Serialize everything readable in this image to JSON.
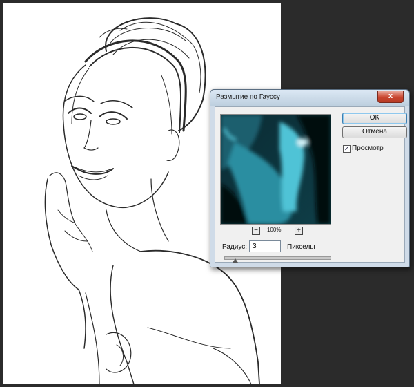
{
  "dialog": {
    "title": "Размытие по Гауссу",
    "close_glyph": "x",
    "ok_label": "OK",
    "cancel_label": "Отмена",
    "preview_label": "Просмотр",
    "preview_checked": true,
    "check_glyph": "✓",
    "zoom_level": "100%",
    "zoom_out_glyph": "−",
    "zoom_in_glyph": "+",
    "radius_label": "Радиус:",
    "radius_value": "3",
    "units_label": "Пикселы",
    "slider_value_fraction": 0.1
  },
  "colors": {
    "workspace_bg": "#2b2b2b",
    "document_bg": "#ffffff",
    "dialog_frame": "#cfdbe8",
    "preview_tint": "#4fc3d6",
    "close_button": "#c9452f"
  },
  "icons": {
    "close": "close-icon",
    "zoom_out": "zoom-out-icon",
    "zoom_in": "zoom-in-icon",
    "checkbox": "checkmark-icon"
  }
}
